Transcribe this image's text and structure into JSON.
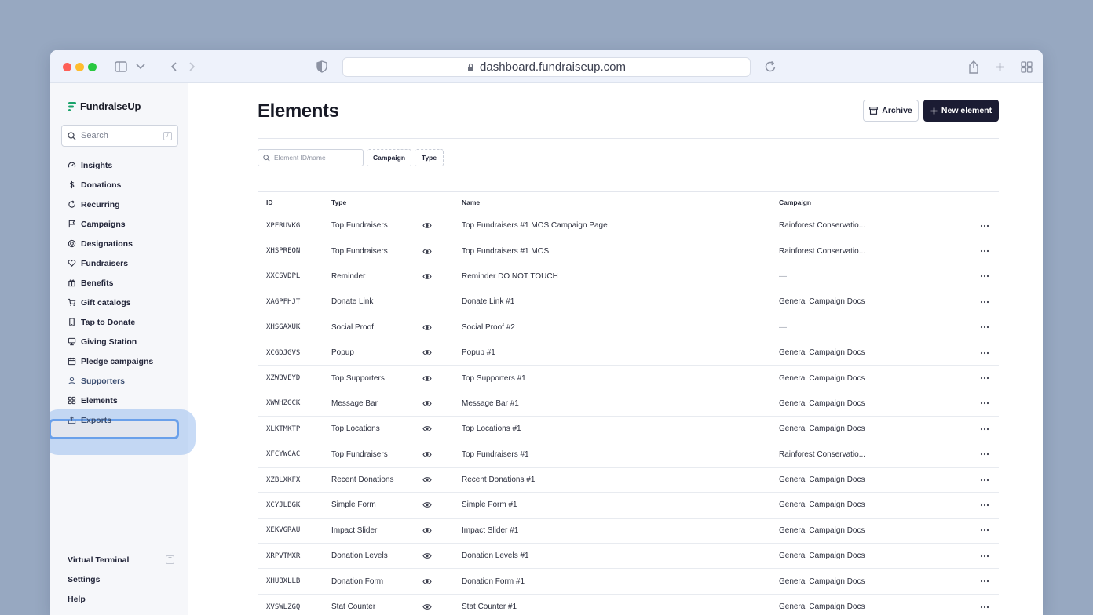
{
  "browser": {
    "url": "dashboard.fundraiseup.com"
  },
  "sidebar": {
    "logo": "FundraiseUp",
    "search_placeholder": "Search",
    "search_shortcut": "/",
    "items": [
      {
        "label": "Insights",
        "icon": "gauge-icon"
      },
      {
        "label": "Donations",
        "icon": "dollar-icon"
      },
      {
        "label": "Recurring",
        "icon": "refresh-icon"
      },
      {
        "label": "Campaigns",
        "icon": "flag-icon"
      },
      {
        "label": "Designations",
        "icon": "target-icon"
      },
      {
        "label": "Fundraisers",
        "icon": "heart-icon"
      },
      {
        "label": "Benefits",
        "icon": "bookmark-icon"
      },
      {
        "label": "Gift catalogs",
        "icon": "cart-icon"
      },
      {
        "label": "Tap to Donate",
        "icon": "phone-icon"
      },
      {
        "label": "Giving Station",
        "icon": "monitor-icon"
      },
      {
        "label": "Pledge campaigns",
        "icon": "calendar-icon"
      },
      {
        "label": "Supporters",
        "icon": "person-icon"
      },
      {
        "label": "Elements",
        "icon": "grid-icon"
      },
      {
        "label": "Exports",
        "icon": "export-icon"
      }
    ],
    "active_item": "Elements",
    "bottom": {
      "virtual_terminal": "Virtual Terminal",
      "virtual_terminal_shortcut": "T",
      "settings": "Settings",
      "help": "Help"
    }
  },
  "page": {
    "title": "Elements",
    "archive_label": "Archive",
    "new_element_label": "New element"
  },
  "filters": {
    "search_placeholder": "Element ID/name",
    "campaign_chip": "Campaign",
    "type_chip": "Type"
  },
  "table": {
    "columns": {
      "id": "ID",
      "type": "Type",
      "name": "Name",
      "campaign": "Campaign"
    },
    "rows": [
      {
        "id": "XPERUVKG",
        "type": "Top Fundraisers",
        "eye": true,
        "name": "Top Fundraisers #1 MOS Campaign Page",
        "campaign": "Rainforest Conservatio..."
      },
      {
        "id": "XHSPREQN",
        "type": "Top Fundraisers",
        "eye": true,
        "name": "Top Fundraisers #1 MOS",
        "campaign": "Rainforest Conservatio..."
      },
      {
        "id": "XXCSVDPL",
        "type": "Reminder",
        "eye": true,
        "name": "Reminder DO NOT TOUCH",
        "campaign": "—"
      },
      {
        "id": "XAGPFHJT",
        "type": "Donate Link",
        "eye": false,
        "name": "Donate Link #1",
        "campaign": "General Campaign Docs"
      },
      {
        "id": "XHSGAXUK",
        "type": "Social Proof",
        "eye": true,
        "name": "Social Proof #2",
        "campaign": "—"
      },
      {
        "id": "XCGDJGVS",
        "type": "Popup",
        "eye": true,
        "name": "Popup #1",
        "campaign": "General Campaign Docs"
      },
      {
        "id": "XZWBVEYD",
        "type": "Top Supporters",
        "eye": true,
        "name": "Top Supporters #1",
        "campaign": "General Campaign Docs"
      },
      {
        "id": "XWWHZGCK",
        "type": "Message Bar",
        "eye": true,
        "name": "Message Bar #1",
        "campaign": "General Campaign Docs"
      },
      {
        "id": "XLKTMKTP",
        "type": "Top Locations",
        "eye": true,
        "name": "Top Locations #1",
        "campaign": "General Campaign Docs"
      },
      {
        "id": "XFCYWCAC",
        "type": "Top Fundraisers",
        "eye": true,
        "name": "Top Fundraisers #1",
        "campaign": "Rainforest Conservatio..."
      },
      {
        "id": "XZBLXKFX",
        "type": "Recent Donations",
        "eye": true,
        "name": "Recent Donations #1",
        "campaign": "General Campaign Docs"
      },
      {
        "id": "XCYJLBGK",
        "type": "Simple Form",
        "eye": true,
        "name": "Simple Form #1",
        "campaign": "General Campaign Docs"
      },
      {
        "id": "XEKVGRAU",
        "type": "Impact Slider",
        "eye": true,
        "name": "Impact Slider #1",
        "campaign": "General Campaign Docs"
      },
      {
        "id": "XRPVTMXR",
        "type": "Donation Levels",
        "eye": true,
        "name": "Donation Levels #1",
        "campaign": "General Campaign Docs"
      },
      {
        "id": "XHUBXLLB",
        "type": "Donation Form",
        "eye": true,
        "name": "Donation Form #1",
        "campaign": "General Campaign Docs"
      },
      {
        "id": "XVSWLZGQ",
        "type": "Stat Counter",
        "eye": true,
        "name": "Stat Counter #1",
        "campaign": "General Campaign Docs"
      }
    ]
  },
  "colors": {
    "background": "#97a8c1",
    "primary_button": "#1b1c33",
    "focus_ring": "#6aa0ea",
    "logo_green": "#1aa36b"
  }
}
